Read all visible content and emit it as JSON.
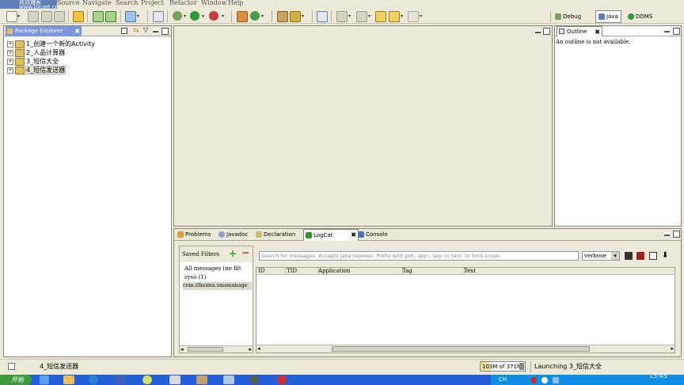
{
  "menu": [
    "Source",
    "Navigate",
    "Search",
    "Project",
    "Refactor",
    "Window",
    "Help"
  ],
  "logo_text": "技成播客 www.bicast.cn",
  "perspectives": {
    "debug": "Debug",
    "java": "Java",
    "ddms": "DDMS"
  },
  "package_explorer": {
    "title": "Package Explorer",
    "projects": [
      "1_创建一个新的Activity",
      "2_人品计算器",
      "3_短信大全",
      "4_短信发送器"
    ]
  },
  "outline": {
    "title": "Outline",
    "message": "An outline is not available."
  },
  "bottom_tabs": [
    "Problems",
    "Javadoc",
    "Declaration",
    "LogCat",
    "Console"
  ],
  "logcat": {
    "saved_filters_label": "Saved Filters",
    "filters": [
      "All messages (no filt",
      "syso (1)",
      "com.itheima.smsmanage"
    ],
    "search_placeholder": "Search for messages. Accepts Java regexes. Prefix with pid:, app:, tag: or text: to limit scope.",
    "level": "verbose",
    "columns": [
      "ID",
      "TID",
      "Application",
      "Tag",
      "Text"
    ]
  },
  "status": {
    "selected": "4_短信发送器",
    "heap": "103M of 371M",
    "launching": "Launching 3_短信大全"
  },
  "taskbar": {
    "start": "开始",
    "lang": "CH",
    "time": "15:45"
  }
}
